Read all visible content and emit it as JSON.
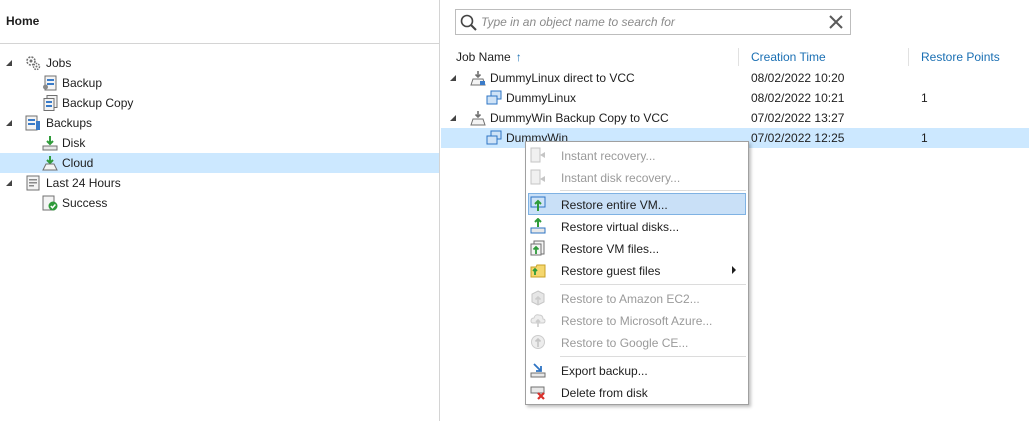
{
  "home": {
    "title": "Home"
  },
  "tree": {
    "items": [
      {
        "label": "Jobs",
        "icon": "jobs-gear-icon"
      },
      {
        "label": "Backup",
        "icon": "backup-job-icon"
      },
      {
        "label": "Backup Copy",
        "icon": "backup-copy-job-icon"
      },
      {
        "label": "Backups",
        "icon": "backups-icon"
      },
      {
        "label": "Disk",
        "icon": "disk-icon"
      },
      {
        "label": "Cloud",
        "icon": "cloud-repository-icon",
        "selected": true
      },
      {
        "label": "Last 24 Hours",
        "icon": "last-24-hours-icon"
      },
      {
        "label": "Success",
        "icon": "success-icon"
      }
    ]
  },
  "search": {
    "placeholder": "Type in an object name to search for"
  },
  "grid": {
    "columns": [
      "Job Name",
      "Creation Time",
      "Restore Points"
    ],
    "sort_indicator": "↑",
    "rows": [
      {
        "name": "DummyLinux direct to VCC",
        "creation_time": "08/02/2022 10:20",
        "restore_points": ""
      },
      {
        "name": "DummyLinux",
        "creation_time": "08/02/2022 10:21",
        "restore_points": "1"
      },
      {
        "name": "DummyWin Backup Copy to VCC",
        "creation_time": "07/02/2022 13:27",
        "restore_points": ""
      },
      {
        "name": "DummyWin",
        "creation_time": "07/02/2022 12:25",
        "restore_points": "1",
        "selected": true
      }
    ]
  },
  "context_menu": {
    "items": [
      {
        "label": "Instant recovery...",
        "enabled": false,
        "icon": "instant-recovery-icon"
      },
      {
        "label": "Instant disk recovery...",
        "enabled": false,
        "icon": "instant-disk-recovery-icon"
      },
      {
        "label": "Restore entire VM...",
        "enabled": true,
        "icon": "restore-entire-vm-icon",
        "highlighted": true
      },
      {
        "label": "Restore virtual disks...",
        "enabled": true,
        "icon": "restore-virtual-disks-icon"
      },
      {
        "label": "Restore VM files...",
        "enabled": true,
        "icon": "restore-vm-files-icon"
      },
      {
        "label": "Restore guest files",
        "enabled": true,
        "icon": "restore-guest-files-icon",
        "submenu": true
      },
      {
        "label": "Restore to Amazon EC2...",
        "enabled": false,
        "icon": "amazon-ec2-icon"
      },
      {
        "label": "Restore to Microsoft Azure...",
        "enabled": false,
        "icon": "microsoft-azure-icon"
      },
      {
        "label": "Restore to Google CE...",
        "enabled": false,
        "icon": "google-ce-icon"
      },
      {
        "label": "Export backup...",
        "enabled": true,
        "icon": "export-backup-icon"
      },
      {
        "label": "Delete from disk",
        "enabled": true,
        "icon": "delete-from-disk-icon"
      }
    ]
  },
  "colors": {
    "selection": "#cce8ff",
    "menu_highlight": "#c9e0f7",
    "header_link": "#1a6fb3",
    "disabled_text": "#9a9a9a"
  }
}
